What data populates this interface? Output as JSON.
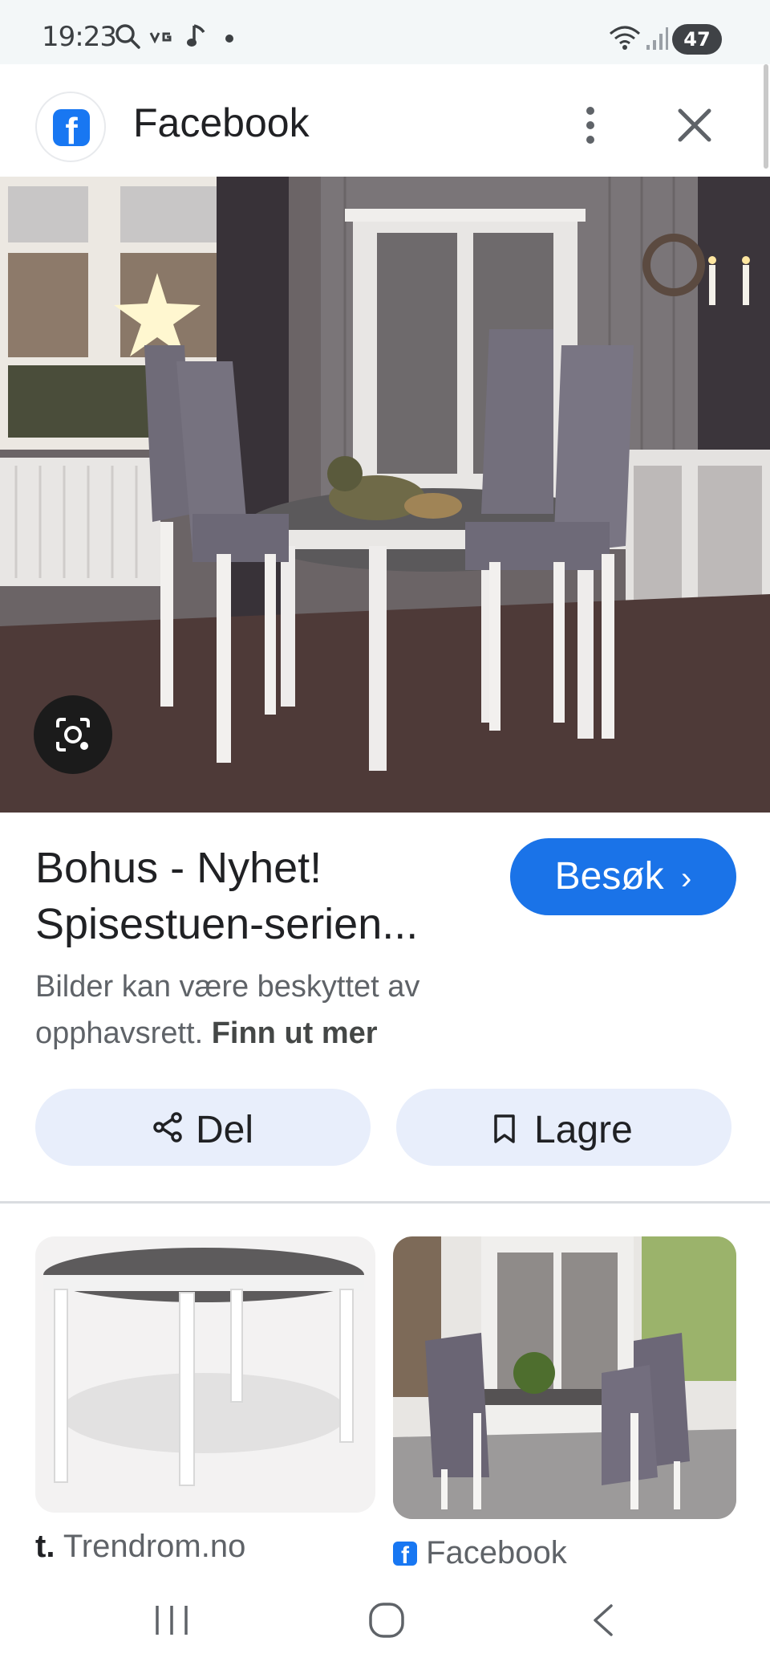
{
  "status_bar": {
    "time": "19:23",
    "battery": "47",
    "icons": [
      "search-icon",
      "vg-icon",
      "music-note-icon",
      "dot-icon",
      "wifi-icon",
      "signal-icon",
      "battery-icon"
    ]
  },
  "header": {
    "title": "Facebook",
    "app_icon": "facebook-icon",
    "more_icon": "more-vertical-icon",
    "close_icon": "close-icon"
  },
  "result": {
    "title": "Bohus - Nyhet! Spisestuen-serien...",
    "visit_label": "Besøk",
    "visit_icon": "chevron-right-icon",
    "copyright_text": "Bilder kan være beskyttet av opphavsrett.",
    "copyright_link": "Finn ut mer",
    "lens_icon": "google-lens-icon"
  },
  "actions": {
    "share_label": "Del",
    "share_icon": "share-icon",
    "save_label": "Lagre",
    "save_icon": "bookmark-icon"
  },
  "related": [
    {
      "source": "Trendrom.no",
      "source_icon": "trendrom-icon"
    },
    {
      "source": "Facebook",
      "source_icon": "facebook-icon"
    }
  ],
  "nav_bar": {
    "icons": [
      "recents-icon",
      "home-icon",
      "back-icon"
    ]
  },
  "colors": {
    "accent": "#1a73e8",
    "button_bg": "#e8eefb",
    "status_bg": "#f3f7f8",
    "facebook_blue": "#1877f2"
  }
}
